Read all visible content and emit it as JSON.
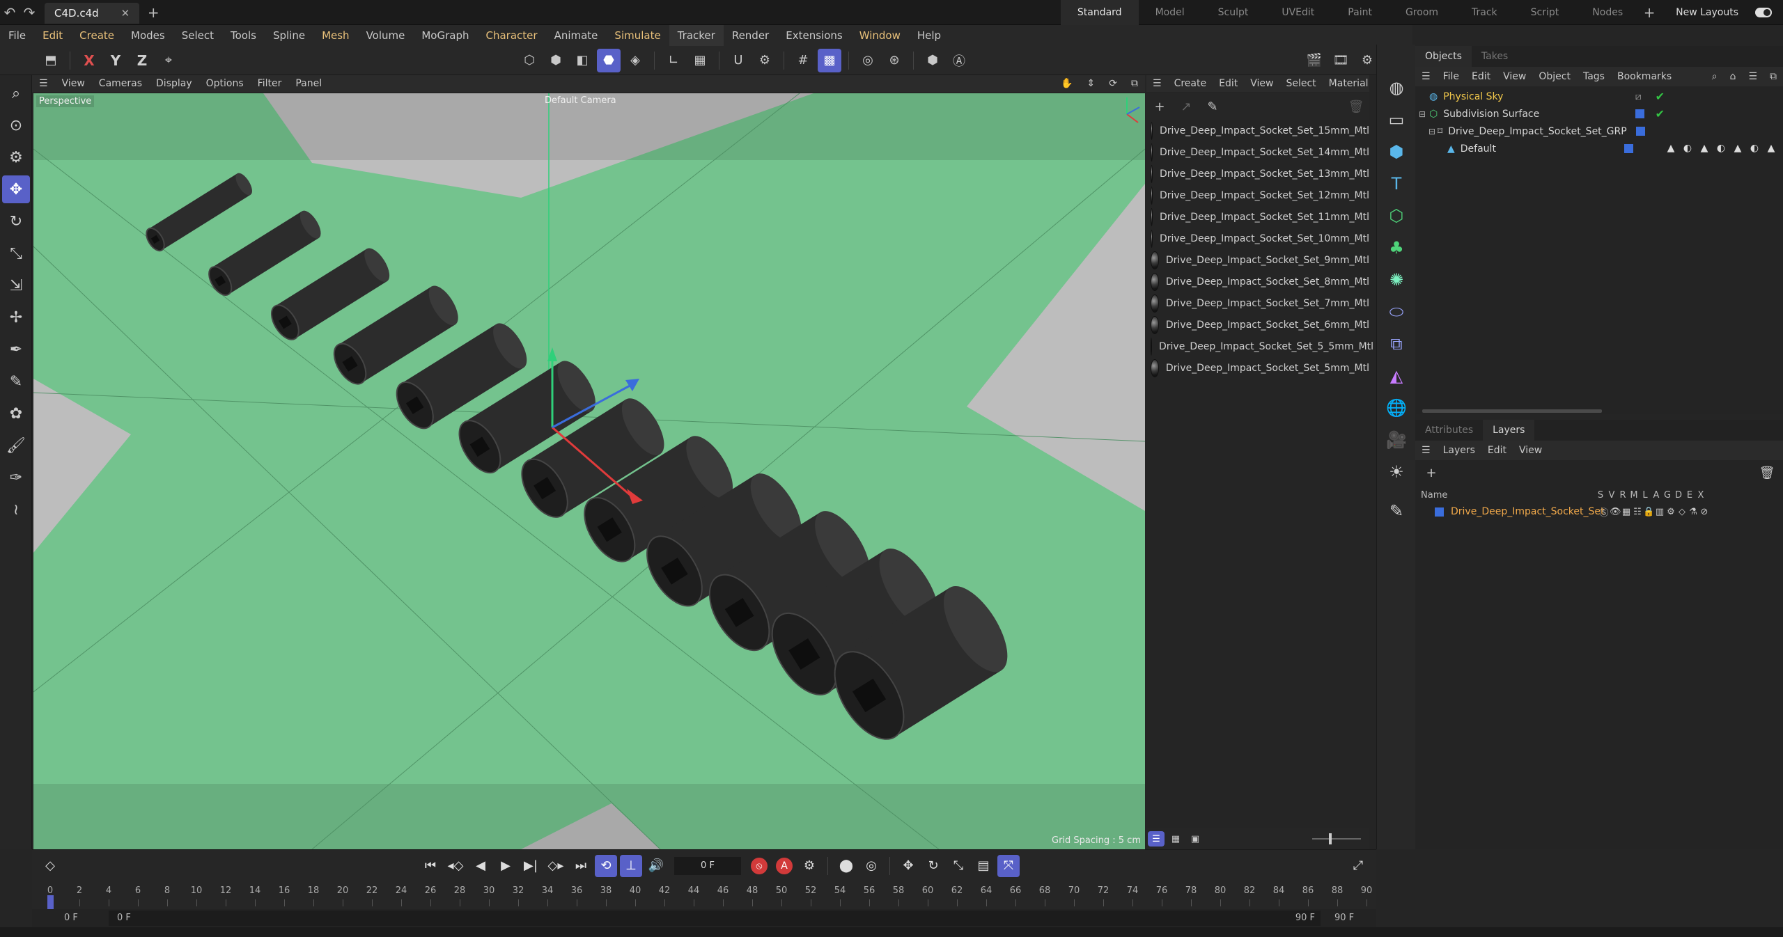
{
  "topbar": {
    "doc_tab": "C4D.c4d",
    "layouts": [
      "Standard",
      "Model",
      "Sculpt",
      "UVEdit",
      "Paint",
      "Groom",
      "Track",
      "Script",
      "Nodes"
    ],
    "new_layouts": "New Layouts"
  },
  "menubar": [
    "File",
    "Edit",
    "Create",
    "Modes",
    "Select",
    "Tools",
    "Spline",
    "Mesh",
    "Volume",
    "MoGraph",
    "Character",
    "Animate",
    "Simulate",
    "Tracker",
    "Render",
    "Extensions",
    "Window",
    "Help"
  ],
  "viewport": {
    "menu": [
      "View",
      "Cameras",
      "Display",
      "Options",
      "Filter",
      "Panel"
    ],
    "label": "Perspective",
    "camera": "Default Camera",
    "grid_spacing": "Grid Spacing : 5 cm",
    "colors": {
      "floor": "#74c38e",
      "object": "#2a2a2a",
      "accent": "#5961c8"
    }
  },
  "materials": {
    "menu": [
      "Create",
      "Edit",
      "View",
      "Select",
      "Material"
    ],
    "items": [
      "Drive_Deep_Impact_Socket_Set_15mm_Mtl",
      "Drive_Deep_Impact_Socket_Set_14mm_Mtl",
      "Drive_Deep_Impact_Socket_Set_13mm_Mtl",
      "Drive_Deep_Impact_Socket_Set_12mm_Mtl",
      "Drive_Deep_Impact_Socket_Set_11mm_Mtl",
      "Drive_Deep_Impact_Socket_Set_10mm_Mtl",
      "Drive_Deep_Impact_Socket_Set_9mm_Mtl",
      "Drive_Deep_Impact_Socket_Set_8mm_Mtl",
      "Drive_Deep_Impact_Socket_Set_7mm_Mtl",
      "Drive_Deep_Impact_Socket_Set_6mm_Mtl",
      "Drive_Deep_Impact_Socket_Set_5_5mm_Mtl",
      "Drive_Deep_Impact_Socket_Set_5mm_Mtl"
    ]
  },
  "objects": {
    "tabs": [
      "Objects",
      "Takes"
    ],
    "menu": [
      "File",
      "Edit",
      "View",
      "Object",
      "Tags",
      "Bookmarks"
    ],
    "tree": [
      "Physical Sky",
      "Subdivision Surface",
      "Drive_Deep_Impact_Socket_Set_GRP",
      "Default"
    ]
  },
  "layers": {
    "tabs": [
      "Attributes",
      "Layers"
    ],
    "menu": [
      "Layers",
      "Edit",
      "View"
    ],
    "name_header": "Name",
    "flags": [
      "S",
      "V",
      "R",
      "M",
      "L",
      "A",
      "G",
      "D",
      "E",
      "X"
    ],
    "layer_name": "Drive_Deep_Impact_Socket_Set"
  },
  "timeline": {
    "current_frame": "0 F",
    "ticks": [
      "0",
      "2",
      "4",
      "6",
      "8",
      "10",
      "12",
      "14",
      "16",
      "18",
      "20",
      "22",
      "24",
      "26",
      "28",
      "30",
      "32",
      "34",
      "36",
      "38",
      "40",
      "42",
      "44",
      "46",
      "48",
      "50",
      "52",
      "54",
      "56",
      "58",
      "60",
      "62",
      "64",
      "66",
      "68",
      "70",
      "72",
      "74",
      "76",
      "78",
      "80",
      "82",
      "84",
      "86",
      "88",
      "90"
    ],
    "range_start": "0 F",
    "range_start2": "0 F",
    "range_end": "90 F",
    "range_end2": "90 F"
  }
}
